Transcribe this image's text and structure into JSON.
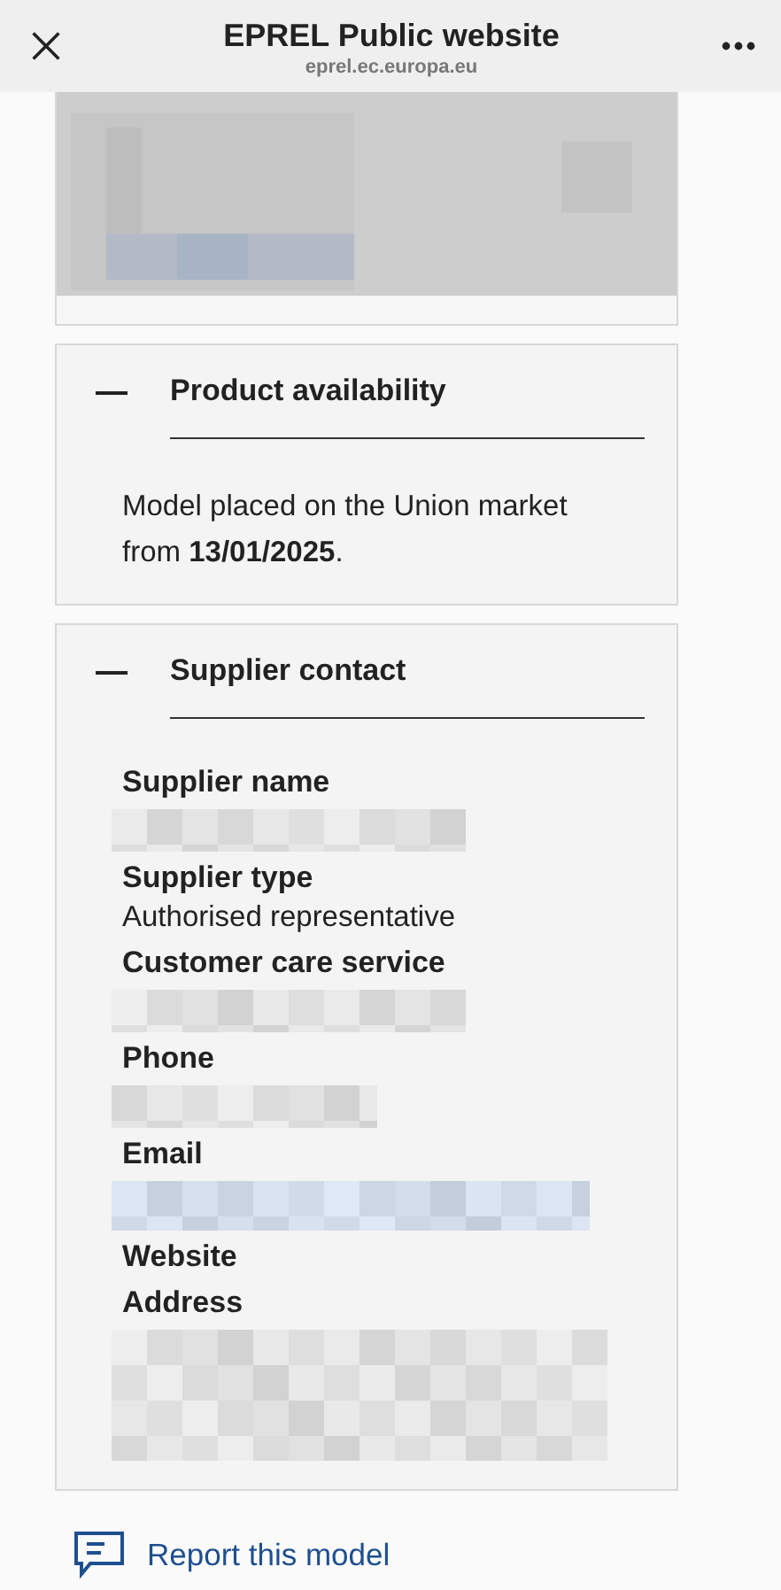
{
  "header": {
    "title": "EPREL Public website",
    "url": "eprel.ec.europa.eu"
  },
  "sections": [
    {
      "title": "Product availability",
      "expanded": true,
      "kind": "text",
      "text": "Model placed on the Union market from **13/01/2025**."
    },
    {
      "title": "Supplier contact",
      "expanded": true,
      "kind": "fields",
      "fields": [
        {
          "label": "Supplier name",
          "redacted": true
        },
        {
          "label": "Supplier type",
          "value": "Authorised representative",
          "redacted": false
        },
        {
          "label": "Customer care service",
          "redacted": true
        },
        {
          "label": "Phone",
          "redacted": true
        },
        {
          "label": "Email",
          "redacted": true
        },
        {
          "label": "Website",
          "redacted": false
        },
        {
          "label": "Address",
          "redacted": true
        }
      ]
    }
  ],
  "report_link": "Report this model"
}
